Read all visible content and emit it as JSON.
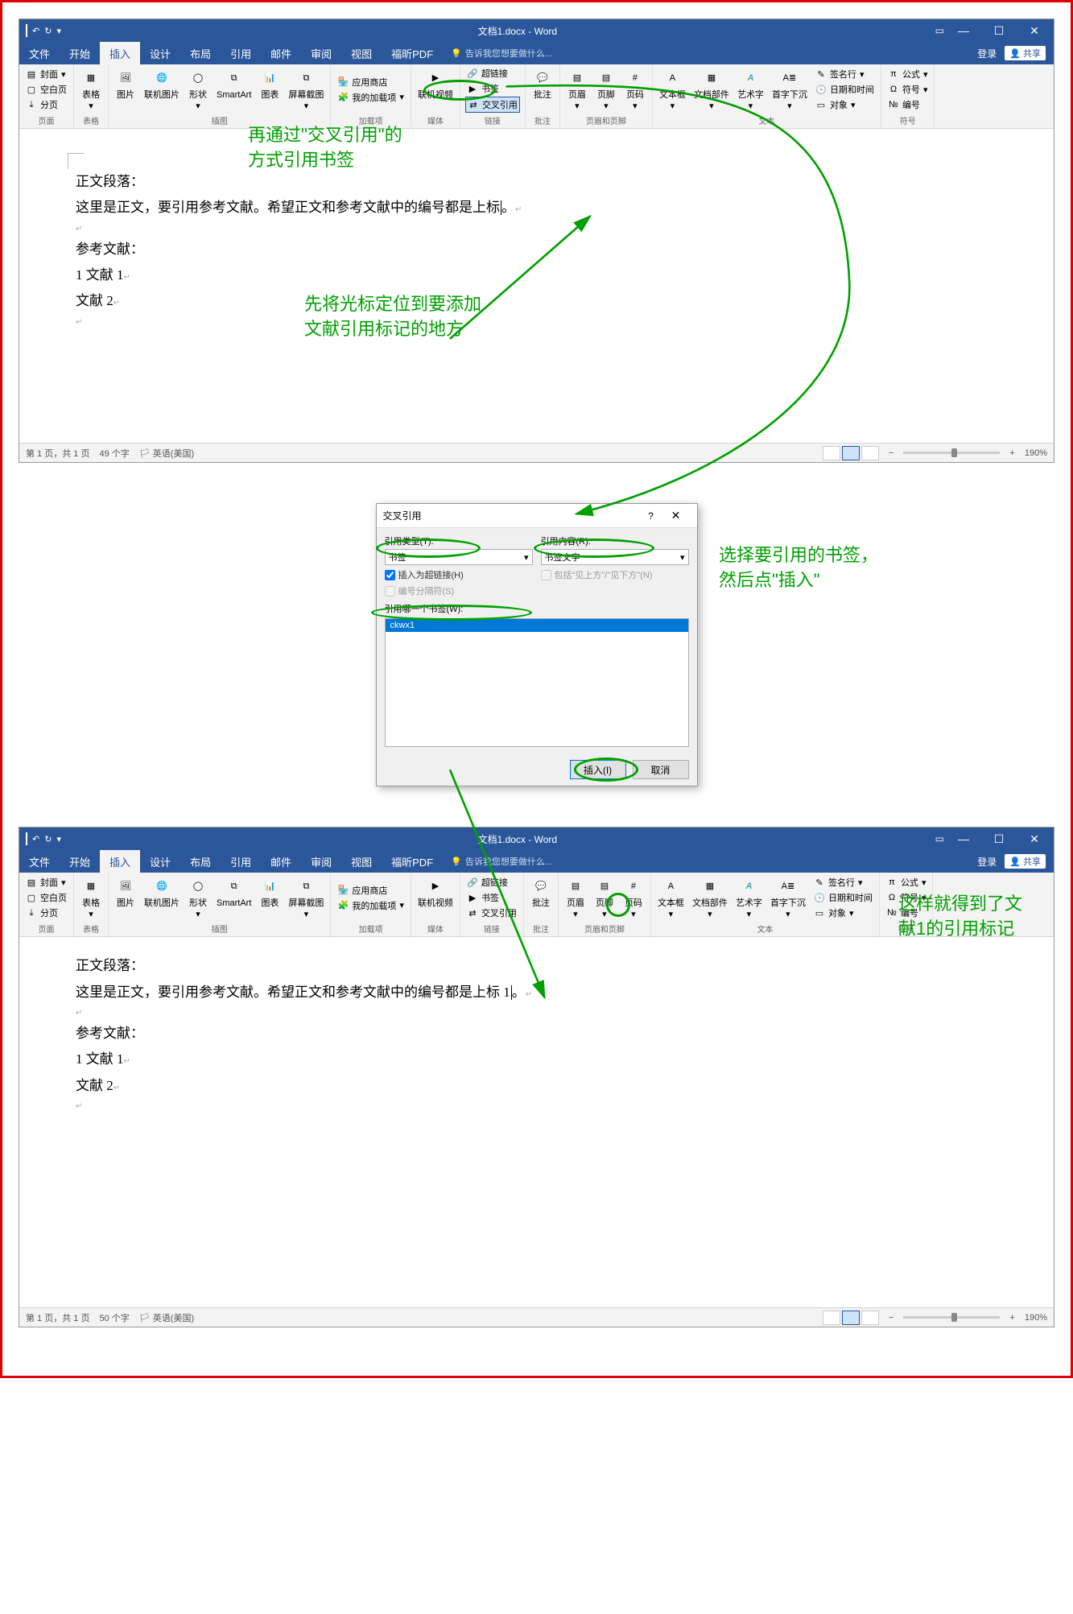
{
  "title_bar": {
    "title": "文档1.docx - Word",
    "login": "登录"
  },
  "menu": {
    "file": "文件",
    "home": "开始",
    "insert": "插入",
    "design": "设计",
    "layout": "布局",
    "references": "引用",
    "mail": "邮件",
    "review": "审阅",
    "view": "视图",
    "foxit": "福昕PDF",
    "tell": "告诉我您想要做什么...",
    "share": "共享"
  },
  "ribbon": {
    "cover": "封面",
    "blank": "空白页",
    "break": "分页",
    "g_page": "页面",
    "table": "表格",
    "g_table": "表格",
    "picture": "图片",
    "online_pic": "联机图片",
    "shapes": "形状",
    "smartart": "SmartArt",
    "chart": "图表",
    "screenshot": "屏幕截图",
    "g_illus": "插图",
    "store": "应用商店",
    "myaddins": "我的加载项",
    "g_addins": "加载项",
    "video": "联机视频",
    "g_media": "媒体",
    "hyperlink": "超链接",
    "bookmark": "书签",
    "crossref": "交叉引用",
    "g_links": "链接",
    "comment": "批注",
    "g_comment": "批注",
    "header": "页眉",
    "footer": "页脚",
    "pagenum": "页码",
    "g_hf": "页眉和页脚",
    "textbox": "文本框",
    "parts": "文档部件",
    "wordart": "艺术字",
    "dropcap": "首字下沉",
    "sigline": "签名行",
    "datetime": "日期和时间",
    "object": "对象",
    "g_text": "文本",
    "equation": "公式",
    "symbol": "符号",
    "number": "编号",
    "g_sym": "符号"
  },
  "doc": {
    "p1": "正文段落：",
    "p2_a": "这里是正文，要引用参考文献。希望正文和参考文献中的编号都是上标",
    "p2_b_after": "这里是正文，要引用参考文献。希望正文和参考文献中的编号都是上标 1",
    "period": "。",
    "ref_title": "参考文献：",
    "ref1": "1 文献 1",
    "ref2": "文献 2"
  },
  "status": {
    "page_a": "第 1 页，共 1 页",
    "words_a": "49 个字",
    "words_b": "50 个字",
    "lang": "英语(美国)",
    "zoom": "190%"
  },
  "dialog": {
    "title": "交叉引用",
    "ref_type_label": "引用类型(T):",
    "ref_type_value": "书签",
    "ref_content_label": "引用内容(R):",
    "ref_content_value": "书签文字",
    "chk_hyperlink": "插入为超链接(H)",
    "chk_separator": "编号分隔符(S)",
    "chk_include": "包括\"见上方\"/\"见下方\"(N)",
    "which_label": "引用哪一个书签(W):",
    "item1": "ckwx1",
    "btn_insert": "插入(I)",
    "btn_cancel": "取消"
  },
  "annotations": {
    "a1": "再通过\"交叉引用\"的\n方式引用书签",
    "a2": "先将光标定位到要添加\n文献引用标记的地方",
    "a3": "选择要引用的书签，\n然后点\"插入\"",
    "a4": "这样就得到了文\n献1的引用标记"
  }
}
